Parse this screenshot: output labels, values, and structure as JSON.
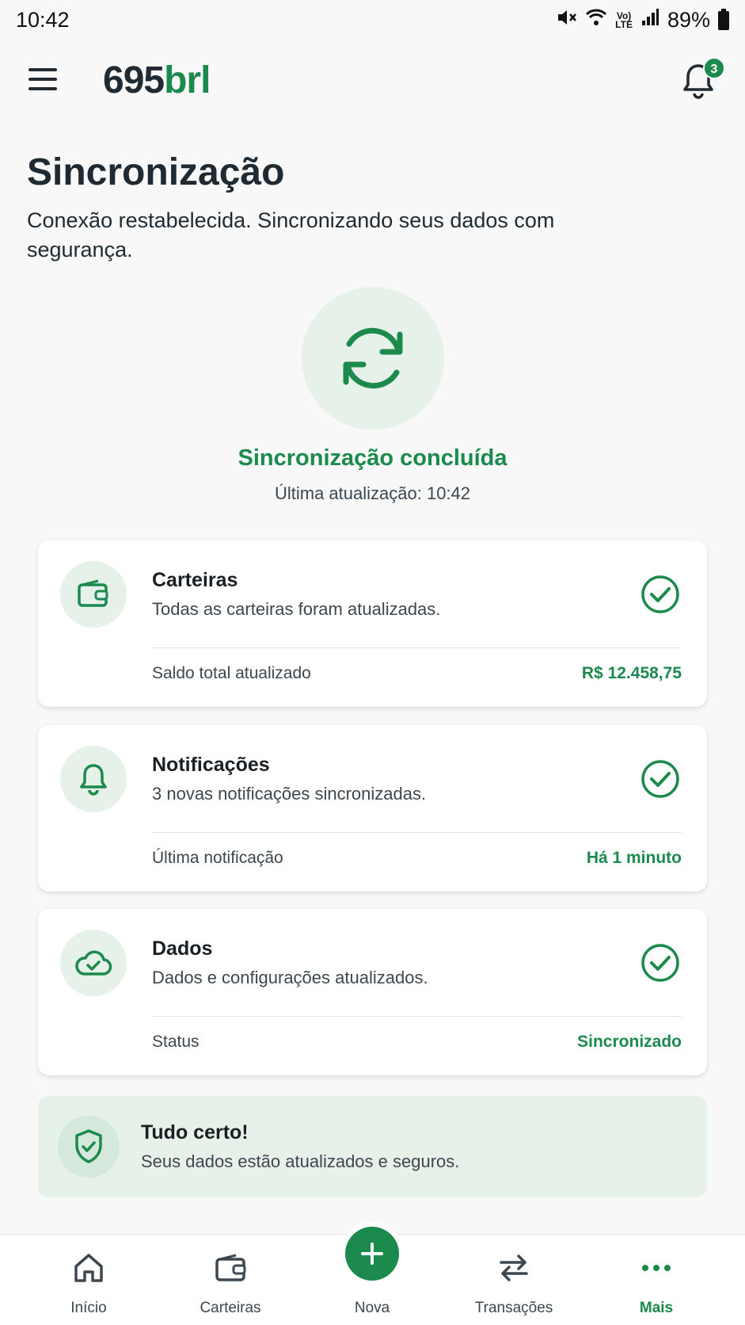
{
  "status_bar": {
    "time": "10:42",
    "volte_line1": "Vo)",
    "volte_line2": "LTE",
    "battery": "89%",
    "icons": [
      "mute-icon",
      "wifi-icon",
      "volte-icon",
      "signal-icon",
      "battery-icon"
    ]
  },
  "header": {
    "logo_number": "695",
    "logo_currency": "brl",
    "notification_count": "3"
  },
  "page": {
    "title": "Sincronização",
    "subtitle": "Conexão restabelecida. Sincronizando seus dados com segurança."
  },
  "sync": {
    "status": "Sincronização concluída",
    "last_update": "Última atualização: 10:42"
  },
  "cards": [
    {
      "title": "Carteiras",
      "description": "Todas as carteiras foram atualizadas.",
      "footer_label": "Saldo total atualizado",
      "footer_value": "R$ 12.458,75",
      "icon": "wallet-icon"
    },
    {
      "title": "Notificações",
      "description": "3 novas notificações sincronizadas.",
      "footer_label": "Última notificação",
      "footer_value": "Há 1 minuto",
      "icon": "bell-icon"
    },
    {
      "title": "Dados",
      "description": "Dados e configurações atualizados.",
      "footer_label": "Status",
      "footer_value": "Sincronizado",
      "icon": "cloud-check-icon"
    }
  ],
  "banner": {
    "title": "Tudo certo!",
    "description": "Seus dados estão atualizados e seguros."
  },
  "bottom_nav": [
    {
      "label": "Início",
      "icon": "home-icon"
    },
    {
      "label": "Carteiras",
      "icon": "wallet-icon"
    },
    {
      "label": "Nova",
      "icon": "plus-icon"
    },
    {
      "label": "Transações",
      "icon": "transfer-icon"
    },
    {
      "label": "Mais",
      "icon": "more-icon",
      "active": true
    }
  ],
  "colors": {
    "accent": "#1b8a4c",
    "accent_light": "#e5f1e9",
    "text_dark": "#1f2a33",
    "text_muted": "#3d4750"
  }
}
